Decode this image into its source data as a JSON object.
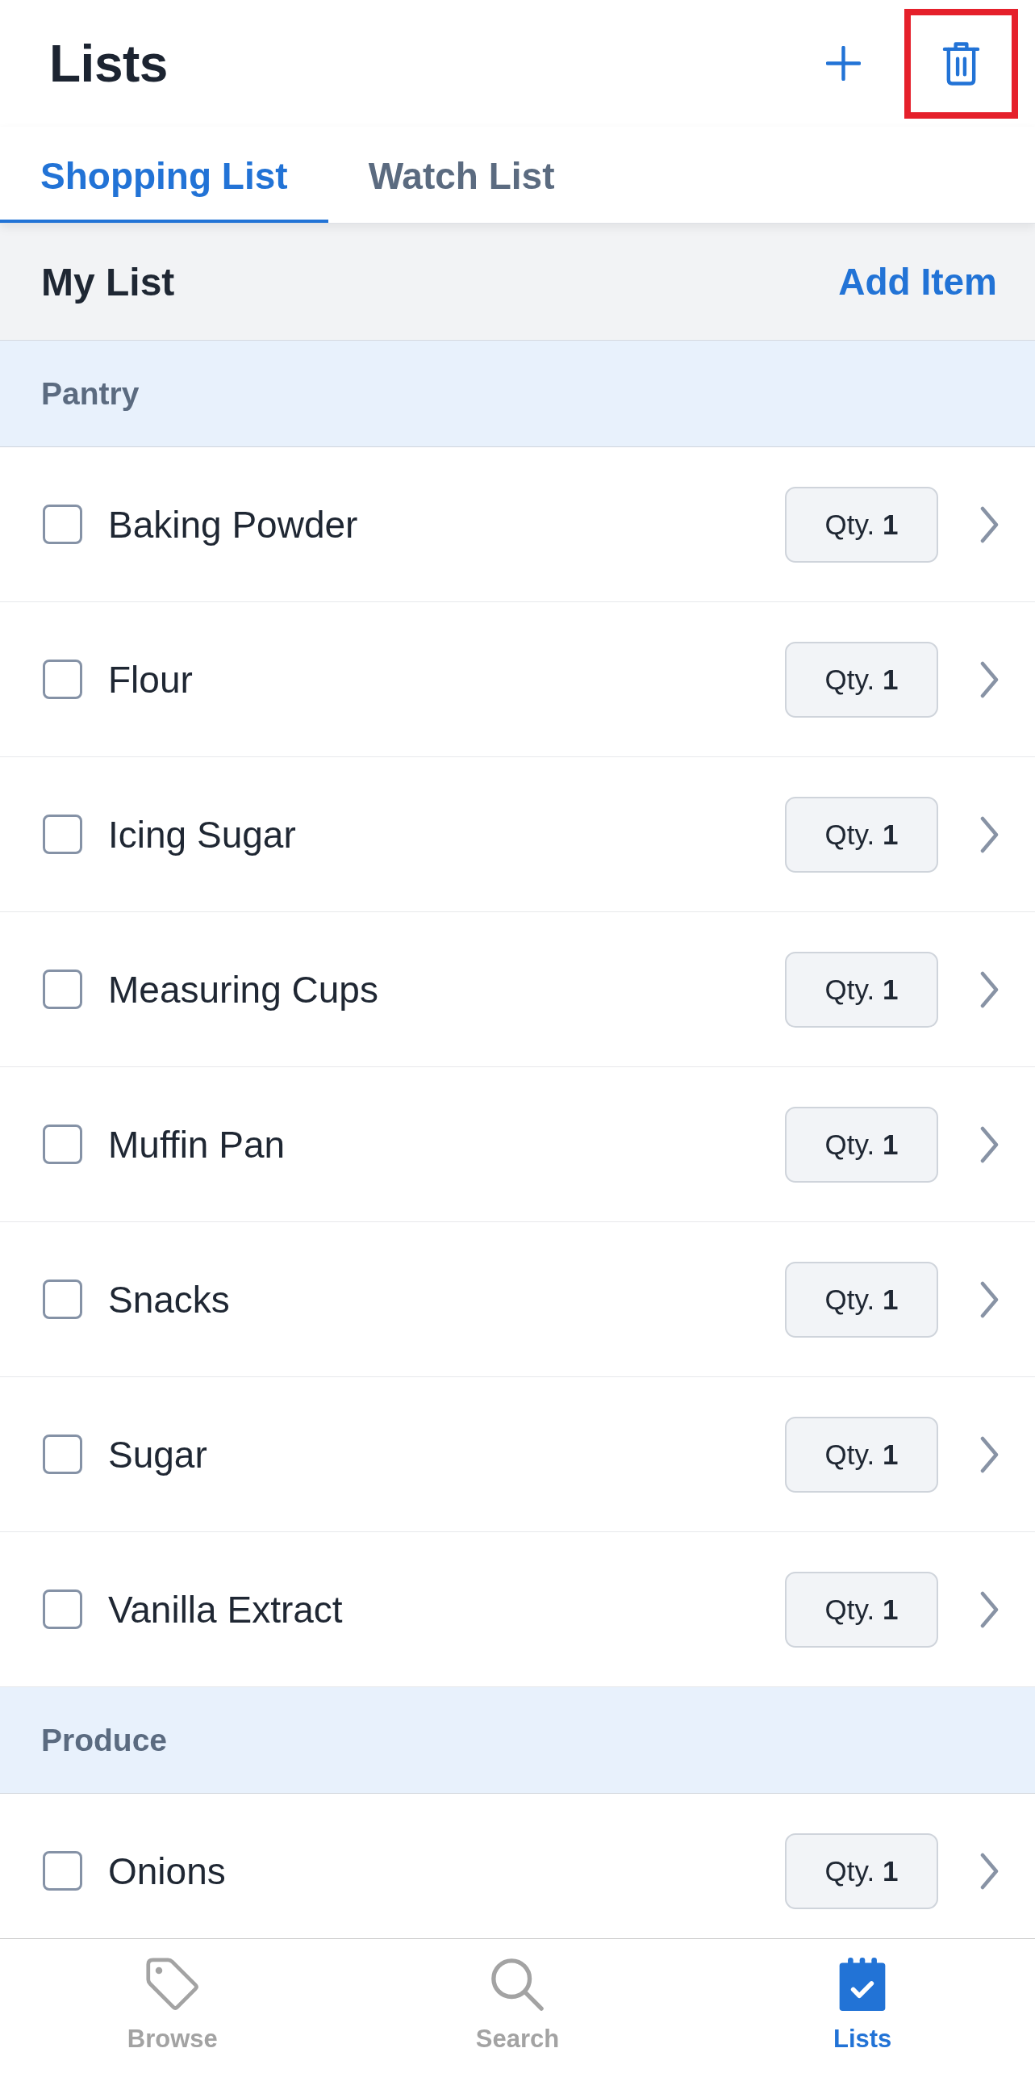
{
  "header": {
    "title": "Lists",
    "actions": [
      {
        "kind": "add",
        "highlighted": false
      },
      {
        "kind": "delete",
        "highlighted": true
      }
    ]
  },
  "tabs": [
    {
      "label": "Shopping List",
      "selected": true
    },
    {
      "label": "Watch List",
      "selected": false
    }
  ],
  "section": {
    "title": "My List",
    "action": "Add Item"
  },
  "groups": [
    {
      "name": "Pantry",
      "items": [
        {
          "name": "Baking Powder",
          "checked": false,
          "quantity": "Qty. **1**"
        },
        {
          "name": "Flour",
          "checked": false,
          "quantity": "Qty. **1**"
        },
        {
          "name": "Icing Sugar",
          "checked": false,
          "quantity": "Qty. **1**"
        },
        {
          "name": "Measuring Cups",
          "checked": false,
          "quantity": "Qty. **1**"
        },
        {
          "name": "Muffin Pan",
          "checked": false,
          "quantity": "Qty. **1**"
        },
        {
          "name": "Snacks",
          "checked": false,
          "quantity": "Qty. **1**"
        },
        {
          "name": "Sugar",
          "checked": false,
          "quantity": "Qty. **1**"
        },
        {
          "name": "Vanilla Extract",
          "checked": false,
          "quantity": "Qty. **1**"
        }
      ]
    },
    {
      "name": "Produce",
      "items": [
        {
          "name": "Onions",
          "checked": false,
          "quantity": "Qty. **1**"
        }
      ]
    }
  ],
  "bottom_nav": [
    {
      "label": "Browse",
      "kind": "tag",
      "selected": false
    },
    {
      "label": "Search",
      "kind": "search",
      "selected": false
    },
    {
      "label": "Lists",
      "kind": "calendar",
      "selected": true
    }
  ]
}
